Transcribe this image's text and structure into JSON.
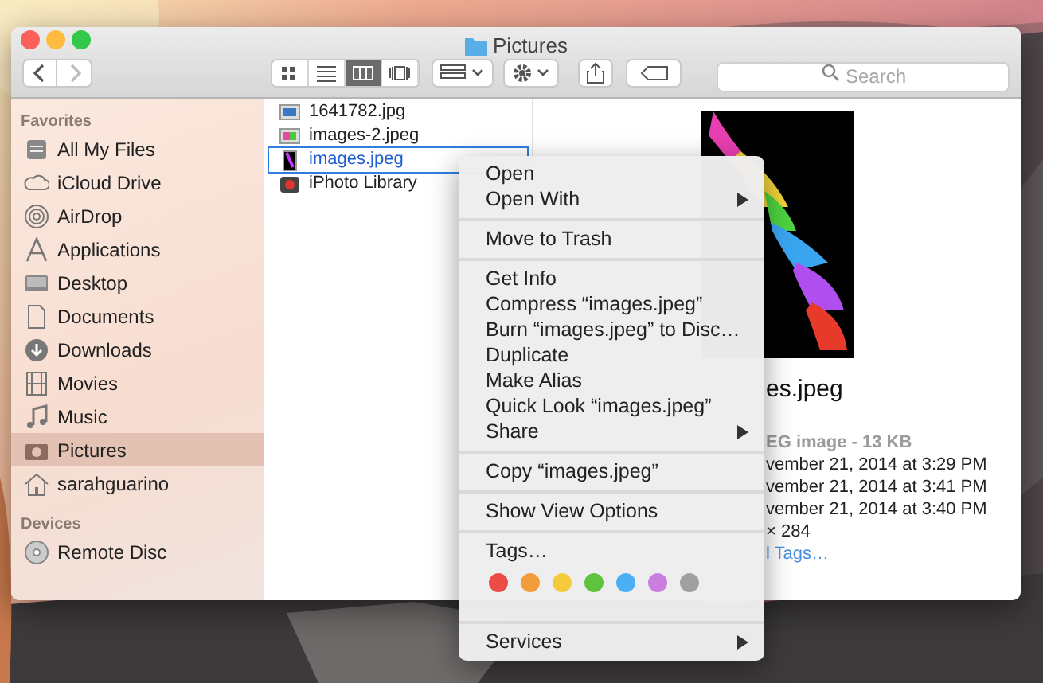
{
  "window": {
    "title": "Pictures"
  },
  "toolbar": {
    "view_buttons": [
      {
        "selected": false
      },
      {
        "selected": false
      },
      {
        "selected": true
      },
      {
        "selected": false
      }
    ],
    "search": {
      "placeholder": "Search"
    }
  },
  "sidebar": {
    "sections": [
      {
        "heading": "Favorites",
        "items": [
          {
            "label": "All My Files",
            "selected": false
          },
          {
            "label": "iCloud Drive",
            "selected": false
          },
          {
            "label": "AirDrop",
            "selected": false
          },
          {
            "label": "Applications",
            "selected": false
          },
          {
            "label": "Desktop",
            "selected": false
          },
          {
            "label": "Documents",
            "selected": false
          },
          {
            "label": "Downloads",
            "selected": false
          },
          {
            "label": "Movies",
            "selected": false
          },
          {
            "label": "Music",
            "selected": false
          },
          {
            "label": "Pictures",
            "selected": true
          },
          {
            "label": "sarahguarino",
            "selected": false
          }
        ]
      },
      {
        "heading": "Devices",
        "items": [
          {
            "label": "Remote Disc",
            "selected": false
          }
        ]
      }
    ]
  },
  "files": [
    {
      "name": "1641782.jpg",
      "selected": false
    },
    {
      "name": "images-2.jpeg",
      "selected": false
    },
    {
      "name": "images.jpeg",
      "selected": true
    },
    {
      "name": "iPhoto Library",
      "selected": false
    }
  ],
  "preview": {
    "name": "es.jpeg",
    "kind": "EG image - 13 KB",
    "dates": [
      "vember 21, 2014 at 3:29 PM",
      "vember 21, 2014 at 3:41 PM",
      "vember 21, 2014 at 3:40 PM"
    ],
    "dimensions": "× 284",
    "tags_link": "l Tags…"
  },
  "context_menu": {
    "items": [
      {
        "kind": "item",
        "label": "Open",
        "submenu": false
      },
      {
        "kind": "item",
        "label": "Open With",
        "submenu": true
      },
      {
        "kind": "separator"
      },
      {
        "kind": "item",
        "label": "Move to Trash",
        "submenu": false
      },
      {
        "kind": "separator"
      },
      {
        "kind": "item",
        "label": "Get Info",
        "submenu": false
      },
      {
        "kind": "item",
        "label": "Compress “images.jpeg”",
        "submenu": false
      },
      {
        "kind": "item",
        "label": "Burn “images.jpeg” to Disc…",
        "submenu": false
      },
      {
        "kind": "item",
        "label": "Duplicate",
        "submenu": false
      },
      {
        "kind": "item",
        "label": "Make Alias",
        "submenu": false
      },
      {
        "kind": "item",
        "label": "Quick Look “images.jpeg”",
        "submenu": false
      },
      {
        "kind": "item",
        "label": "Share",
        "submenu": true
      },
      {
        "kind": "separator"
      },
      {
        "kind": "item",
        "label": "Copy “images.jpeg”",
        "submenu": false
      },
      {
        "kind": "separator"
      },
      {
        "kind": "item",
        "label": "Show View Options",
        "submenu": false
      },
      {
        "kind": "separator"
      },
      {
        "kind": "item",
        "label": "Tags…",
        "submenu": false
      },
      {
        "kind": "tags",
        "tags": [
          {
            "color": "#ec4b46"
          },
          {
            "color": "#f39c3b"
          },
          {
            "color": "#f5cb3b"
          },
          {
            "color": "#5ec440"
          },
          {
            "color": "#4aaff5"
          },
          {
            "color": "#c97ee0"
          },
          {
            "color": "#a0a0a0"
          }
        ]
      },
      {
        "kind": "separator"
      },
      {
        "kind": "item",
        "label": "Services",
        "submenu": true
      }
    ]
  }
}
